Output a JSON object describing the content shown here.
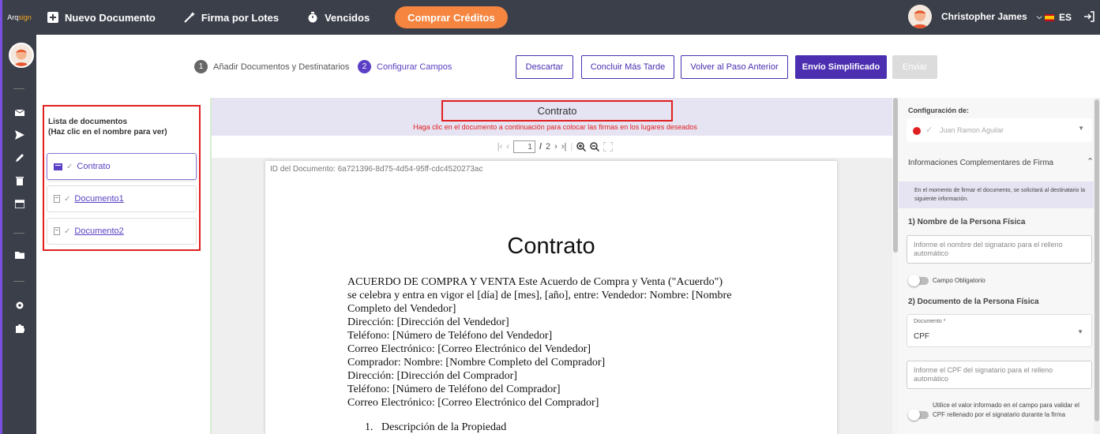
{
  "app": {
    "logo_text_a": "Arq",
    "logo_text_b": "sign"
  },
  "topbar": {
    "new_document": "Nuevo Documento",
    "batch_sign": "Firma por Lotes",
    "expired": "Vencidos",
    "buy_credits": "Comprar Créditos",
    "user_name": "Christopher James",
    "language": "ES"
  },
  "steps": [
    {
      "num": "1",
      "label": "Añadir Documentos y Destinatarios"
    },
    {
      "num": "2",
      "label": "Configurar Campos"
    }
  ],
  "actions": {
    "discard": "Descartar",
    "finish_later": "Concluir Más Tarde",
    "back": "Volver al Paso Anterior",
    "simplified_send": "Envío Simplificado",
    "send": "Enviar"
  },
  "doclist": {
    "title_line1": "Lista de documentos",
    "title_line2": "(Haz clic en el nombre para ver)",
    "items": [
      {
        "label": "Contrato"
      },
      {
        "label": "Documento1"
      },
      {
        "label": "Documento2"
      }
    ]
  },
  "viewer": {
    "doc_title": "Contrato",
    "hint": "Haga clic en el documento a continuación para colocar las firmas en los lugares deseados",
    "current_page": "1",
    "page_sep": "/",
    "total_pages": "2",
    "doc_id": "ID del Documento: 6a721396-8d75-4d54-95ff-cdc4520273ac",
    "heading": "Contrato",
    "body": [
      "ACUERDO DE COMPRA Y VENTA Este Acuerdo de Compra y Venta (\"Acuerdo\")",
      "se celebra y entra en vigor el [día] de [mes], [año], entre: Vendedor: Nombre: [Nombre",
      "Completo del Vendedor]",
      "Dirección: [Dirección del Vendedor]",
      "Teléfono: [Número de Teléfono del Vendedor]",
      "Correo Electrónico: [Correo Electrónico del Vendedor]",
      "Comprador: Nombre: [Nombre Completo del Comprador]",
      "Dirección: [Dirección del Comprador]",
      "Teléfono: [Número de Teléfono del Comprador]",
      "Correo Electrónico: [Correo Electrónico del Comprador]"
    ],
    "list_item": "1.   Descripción de la Propiedad"
  },
  "rpanel": {
    "config_label": "Configuración de:",
    "signer": "Juan Ramon Aguilar",
    "section_title": "Informaciones Complementares de Firma",
    "info_text": "En el momento de firmar el documento, se solicitará al destinatario la siguiente información.",
    "field1_title": "1) Nombre de la Persona Física",
    "field1_placeholder": "Informe el nombre del signatario para el relleno automático",
    "required_label": "Campo Obligatorio",
    "field2_title": "2) Documento de la Persona Física",
    "doc_type_label": "Documento *",
    "doc_type_value": "CPF",
    "field2_placeholder": "Informe el CPF del signatario para el relleno automático",
    "validate_label": "Utilice el valor informado en el campo para validar el CPF rellenado por el signatario durante la firma"
  },
  "colors": {
    "accent": "#4b2fb0",
    "orange": "#f5853f",
    "topbar": "#3b3f4a",
    "highlight": "#e02020"
  }
}
